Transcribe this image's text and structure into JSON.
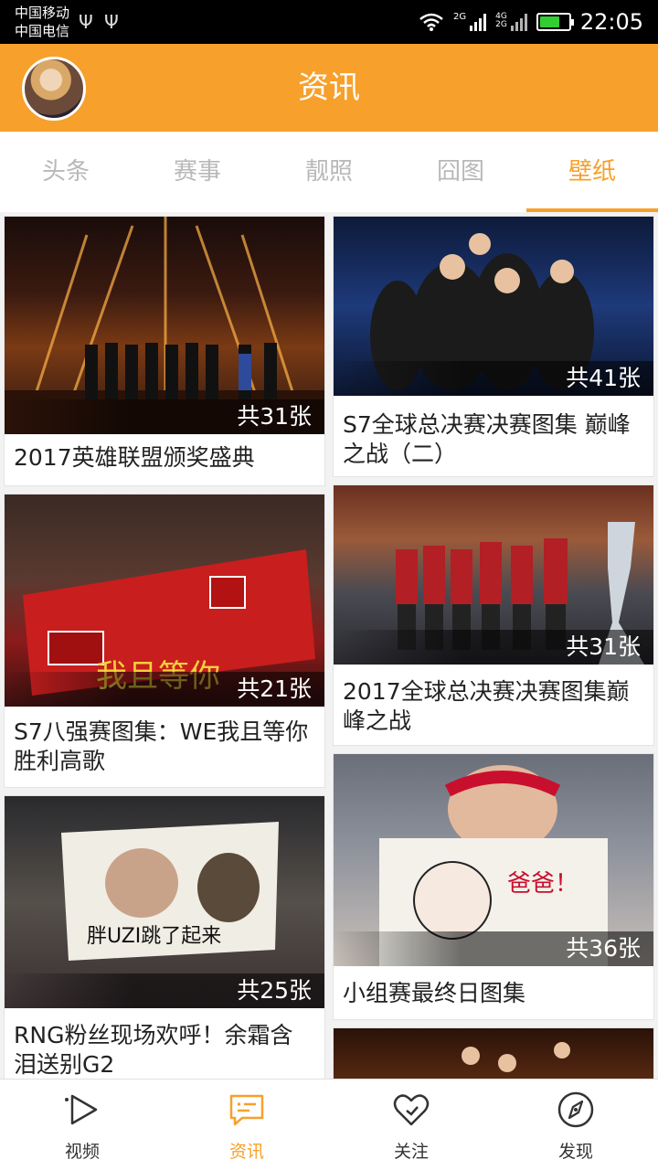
{
  "status_bar": {
    "carrier_1": "中国移动",
    "carrier_2": "中国电信",
    "usb_icon": "usb-icon",
    "signal_1_label": "2G",
    "signal_2_label": "4G\n2G",
    "time": "22:05",
    "battery_color": "#33cc33"
  },
  "header": {
    "title": "资讯",
    "accent_color": "#f7a02b"
  },
  "tabs": [
    {
      "label": "头条",
      "active": false
    },
    {
      "label": "赛事",
      "active": false
    },
    {
      "label": "靓照",
      "active": false
    },
    {
      "label": "囧图",
      "active": false
    },
    {
      "label": "壁纸",
      "active": true
    }
  ],
  "cards": [
    {
      "count": "共31张",
      "title": "2017英雄联盟颁奖盛典"
    },
    {
      "count": "共41张",
      "title": "S7全球总决赛决赛图集 巅峰之战（二）"
    },
    {
      "count": "共21张",
      "title": "S7八强赛图集：WE我且等你胜利高歌"
    },
    {
      "count": "共31张",
      "title": "2017全球总决赛决赛图集巅峰之战"
    },
    {
      "count": "共25张",
      "title": "RNG粉丝现场欢呼！余霜含泪送别G2"
    },
    {
      "count": "共36张",
      "title": "小组赛最终日图集"
    },
    {
      "count": "",
      "title": ""
    }
  ],
  "bottom_nav": [
    {
      "label": "视频",
      "icon": "play-icon",
      "active": false
    },
    {
      "label": "资讯",
      "icon": "message-icon",
      "active": true
    },
    {
      "label": "关注",
      "icon": "heart-icon",
      "active": false
    },
    {
      "label": "发现",
      "icon": "compass-icon",
      "active": false
    }
  ]
}
